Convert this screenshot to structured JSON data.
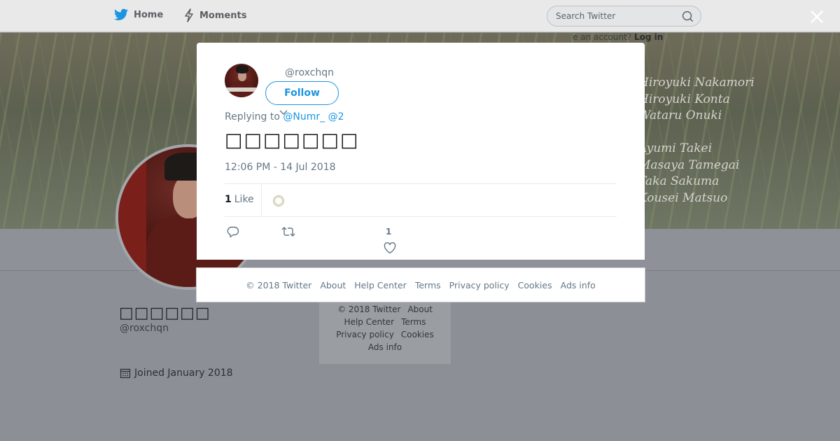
{
  "nav": {
    "home": "Home",
    "moments": "Moments",
    "search_placeholder": "Search Twitter"
  },
  "banner": {
    "signin_prefix": "e an account?",
    "login": "Log in",
    "credits": "Hiroyuki Nakamori\nHiroyuki Konta\nWataru Onuki\n\nAyumi Takei\nMasaya Tamegai\nTaka Sakuma\nKousei Matsuo"
  },
  "profile": {
    "name": "□□□□□□",
    "handle": "@roxchqn",
    "joined": "Joined January 2018"
  },
  "side_footer": {
    "links": [
      "© 2018 Twitter",
      "About",
      "Help Center",
      "Terms",
      "Privacy policy",
      "Cookies",
      "Ads info"
    ]
  },
  "modal": {
    "handle": "@roxchqn",
    "follow_label": "Follow",
    "replying_prefix": "Replying to",
    "replying_mentions": "@Numr_ @2",
    "tweet_text": "□□□□□□□",
    "timestamp": "12:06 PM - 14 Jul 2018",
    "likes_count": "1",
    "likes_label": "Like",
    "action_like_count": "1"
  },
  "modal_footer": {
    "links": [
      "© 2018 Twitter",
      "About",
      "Help Center",
      "Terms",
      "Privacy policy",
      "Cookies",
      "Ads info"
    ]
  },
  "colors": {
    "twitter_blue": "#1b95e0",
    "muted_text": "#657786",
    "overlay": "#8c9096"
  }
}
